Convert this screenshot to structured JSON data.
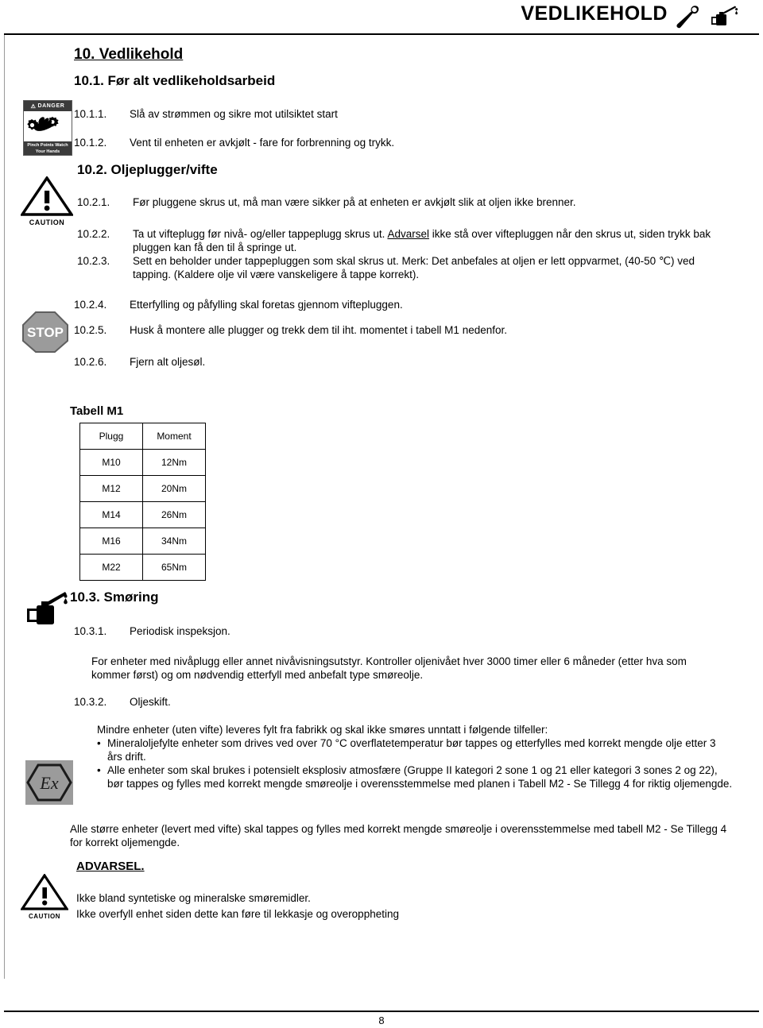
{
  "header": {
    "title": "VEDLIKEHOLD",
    "wrench_icon": "wrench-icon",
    "oilcan_icon": "oil-can-icon"
  },
  "headings": {
    "h1": "10. Vedlikehold",
    "h2_1": "10.1. Før alt vedlikeholdsarbeid",
    "h2_2": "10.2. Oljeplugger/vifte",
    "h2_3": "10.3. Smøring"
  },
  "section_10_1": [
    {
      "num": "10.1.1.",
      "text": "Slå av strømmen og sikre mot utilsiktet start"
    },
    {
      "num": "10.1.2.",
      "text": "Vent til enheten er avkjølt - fare for forbrenning og trykk."
    }
  ],
  "section_10_2": {
    "item1": {
      "num": "10.2.1.",
      "text": "Før pluggene skrus ut, må man være sikker på at enheten er avkjølt slik at oljen ikke brenner."
    },
    "item2": {
      "num": "10.2.2.",
      "text_before": "Ta ut vifteplugg før nivå- og/eller tappeplugg skrus ut. ",
      "underlined": "Advarsel",
      "text_after": " ikke stå over viftepluggen når den skrus ut, siden trykk bak pluggen kan få den til å springe ut."
    },
    "item3": {
      "num": "10.2.3.",
      "text": "Sett en beholder under tappepluggen som skal skrus ut. Merk: Det anbefales at oljen er lett oppvarmet, (40-50 ℃) ved tapping. (Kaldere olje vil være vanskeligere å tappe korrekt)."
    },
    "item4": {
      "num": "10.2.4.",
      "text": "Etterfylling og påfylling skal foretas gjennom viftepluggen."
    },
    "item5": {
      "num": "10.2.5.",
      "text": "Husk å montere alle plugger og trekk dem til iht. momentet i tabell M1 nedenfor."
    },
    "item6": {
      "num": "10.2.6.",
      "text": "Fjern alt oljesøl."
    }
  },
  "table_m1": {
    "title": "Tabell M1",
    "columns": [
      "Plugg",
      "Moment"
    ],
    "rows": [
      [
        "M10",
        "12Nm"
      ],
      [
        "M12",
        "20Nm"
      ],
      [
        "M14",
        "26Nm"
      ],
      [
        "M16",
        "34Nm"
      ],
      [
        "M22",
        "65Nm"
      ]
    ]
  },
  "section_10_3": {
    "item1": {
      "num": "10.3.1.",
      "text": "Periodisk inspeksjon."
    },
    "para1": "For enheter med nivåplugg eller annet nivåvisningsutstyr. Kontroller oljenivået hver 3000 timer eller 6 måneder (etter hva som kommer først) og om nødvendig etterfyll med anbefalt type smøreolje.",
    "item2": {
      "num": "10.3.2.",
      "text": "Oljeskift."
    },
    "para2": "Mindre enheter (uten vifte) leveres fylt fra fabrikk og skal ikke smøres unntatt i følgende tilfeller:",
    "bullet_marker": "•",
    "bullets": [
      "Mineraloljefylte enheter som drives ved over 70 °C overflatetemperatur bør tappes og etterfylles med korrekt mengde olje etter 3 års drift.",
      "Alle enheter som skal brukes i potensielt eksplosiv atmosfære (Gruppe II kategori 2 sone 1 og 21 eller kategori 3 sones 2 og 22), bør tappes og fylles med korrekt mengde smøreolje i overensstemmelse med planen i Tabell M2 - Se Tillegg 4 for riktig oljemengde."
    ],
    "para3": "Alle større enheter (levert med vifte) skal tappes og fylles med korrekt mengde smøreolje i overensstemmelse med tabell M2 - Se Tillegg 4 for korrekt oljemengde."
  },
  "warning": {
    "title": "ADVARSEL.",
    "line1": "Ikke bland syntetiske og mineralske smøremidler.",
    "line2": "Ikke overfyll enhet siden dette kan føre til lekkasje og overoppheting"
  },
  "icons": {
    "danger_label_top": "DANGER",
    "danger_label_bottom": "Pinch Points Watch Your Hands",
    "caution_word": "CAUTION",
    "stop_word": "STOP",
    "ex_word": "Ex"
  },
  "footer": {
    "page_number": "8"
  }
}
